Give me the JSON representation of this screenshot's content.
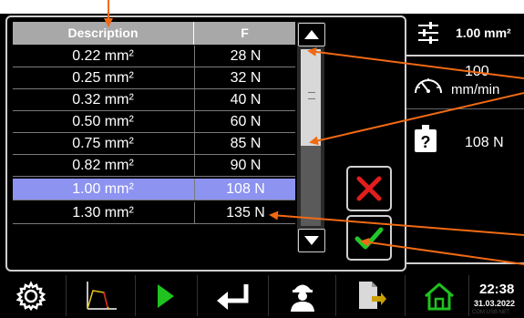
{
  "header": {
    "filter_icon": "sliders-icon",
    "current_value": "1.00 mm²"
  },
  "info": {
    "speed_icon": "speedometer-icon",
    "speed_value": "100",
    "speed_unit": "mm/min",
    "weight_icon": "unknown-weight-icon",
    "force_value": "108 N"
  },
  "table": {
    "headers": [
      "Description",
      "F"
    ],
    "rows": [
      {
        "description": "0.22 mm²",
        "force": "28 N"
      },
      {
        "description": "0.25 mm²",
        "force": "32 N"
      },
      {
        "description": "0.32 mm²",
        "force": "40 N"
      },
      {
        "description": "0.50 mm²",
        "force": "60 N"
      },
      {
        "description": "0.75 mm²",
        "force": "85 N"
      },
      {
        "description": "0.82 mm²",
        "force": "90 N"
      },
      {
        "description": "1.00 mm²",
        "force": "108 N"
      },
      {
        "description": "1.30 mm²",
        "force": "135 N"
      }
    ],
    "selected_index": 6
  },
  "buttons": {
    "cancel_icon": "red-x-icon",
    "confirm_icon": "green-check-icon",
    "scroll_up_icon": "triangle-up-icon",
    "scroll_down_icon": "triangle-down-icon"
  },
  "toolbar": {
    "items": [
      "gear-icon",
      "chart-icon",
      "play-icon",
      "enter-icon",
      "worker-icon",
      "file-export-icon",
      "home-icon"
    ],
    "time": "22:38",
    "date": "31.03.2022",
    "footer": "COM USB NET"
  },
  "colors": {
    "selected_row": "#8d93f0",
    "header_bg": "#a8a8a8",
    "cancel": "#e21d1d",
    "confirm": "#22c72a",
    "play": "#1fc21f",
    "home": "#1fc21f",
    "annotation": "#f06a14"
  }
}
